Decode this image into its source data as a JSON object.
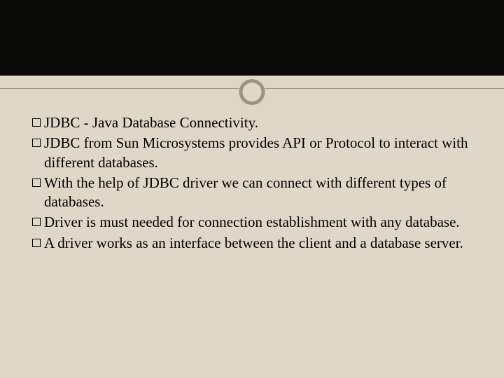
{
  "bullets": [
    "JDBC - Java Database Connectivity.",
    "JDBC from Sun Microsystems provides API or Protocol to interact with different databases.",
    "With the help of JDBC driver we can connect with different types of databases.",
    "Driver is must needed for connection establishment with any database.",
    "A driver works as an interface between the client and a database server."
  ]
}
